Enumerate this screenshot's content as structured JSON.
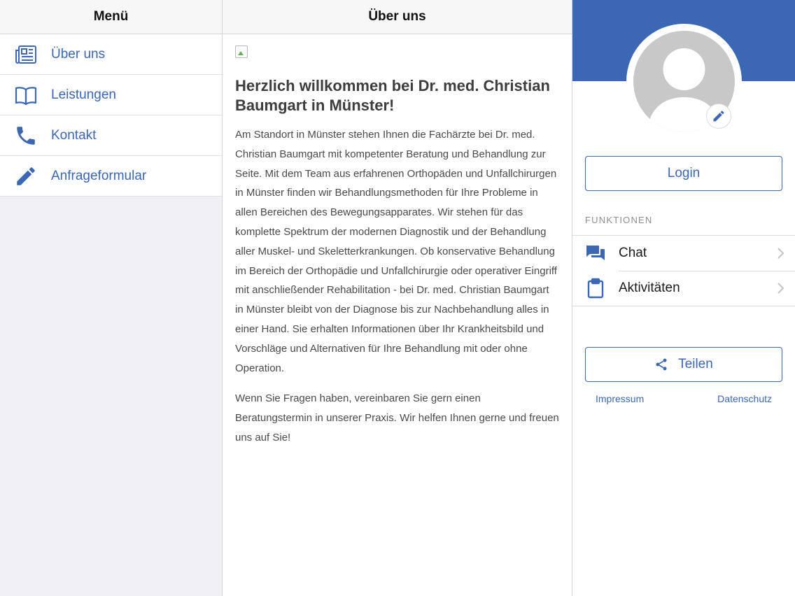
{
  "menu": {
    "title": "Menü",
    "items": [
      {
        "label": "Über uns",
        "icon": "newspaper-icon"
      },
      {
        "label": "Leistungen",
        "icon": "book-icon"
      },
      {
        "label": "Kontakt",
        "icon": "phone-icon"
      },
      {
        "label": "Anfrageformular",
        "icon": "pencil-icon"
      }
    ]
  },
  "content": {
    "title": "Über uns",
    "heading": "Herzlich willkommen bei Dr. med. Christian Baumgart in Münster!",
    "paragraphs": [
      "Am Standort in Münster stehen Ihnen die Fachärzte bei Dr. med. Christian Baumgart mit kompetenter Beratung und Behandlung zur Seite. Mit dem Team aus erfahrenen Orthopäden und Unfallchirurgen in Münster finden wir Behandlungsmethoden für Ihre Probleme in allen Bereichen des Bewegungsapparates. Wir stehen für das komplette Spektrum der modernen Diagnostik und der Behandlung aller Muskel- und Skeletterkrankungen. Ob konservative Behandlung im Bereich der Orthopädie und Unfallchirurgie oder operativer Eingriff mit anschließender Rehabilitation - bei Dr. med. Christian Baumgart in Münster bleibt von der Diagnose bis zur Nachbehandlung alles in einer Hand. Sie erhalten Informationen über Ihr Krankheitsbild und Vorschläge und Alternativen für Ihre Behandlung mit oder ohne Operation.",
      "Wenn Sie Fragen haben, vereinbaren Sie gern einen Beratungstermin in unserer Praxis. Wir helfen Ihnen gerne und freuen uns auf Sie!"
    ]
  },
  "profile": {
    "login_label": "Login",
    "section_label": "FUNKTIONEN",
    "functions": [
      {
        "label": "Chat",
        "icon": "chat-icon"
      },
      {
        "label": "Aktivitäten",
        "icon": "clipboard-icon"
      }
    ],
    "share_label": "Teilen",
    "footer": {
      "impressum": "Impressum",
      "datenschutz": "Datenschutz"
    }
  },
  "colors": {
    "accent": "#3c67b4",
    "menu_bg": "#efeff4",
    "avatar_gray": "#c8c8c8"
  }
}
